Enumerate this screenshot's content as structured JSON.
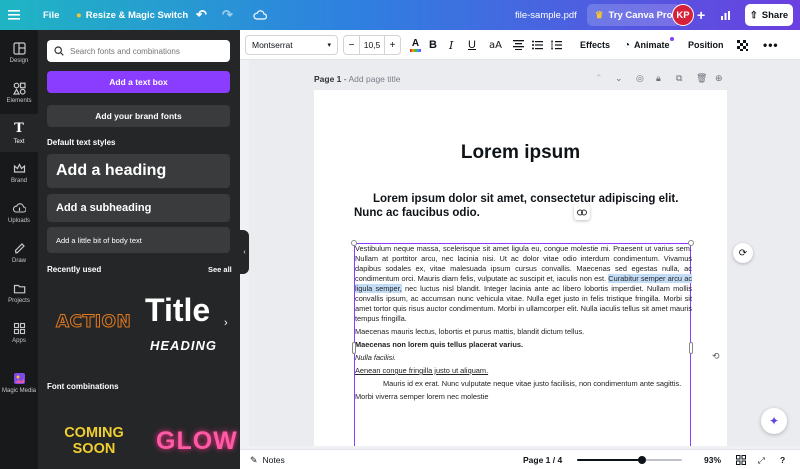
{
  "topbar": {
    "file": "File",
    "resize": "Resize & Magic Switch",
    "filename": "file-sample.pdf",
    "try_pro": "Try Canva Pro",
    "avatar_initials": "KP",
    "share": "Share",
    "gradient_colors": [
      "#1fb5c4",
      "#2f7fe0",
      "#6b3fe0"
    ]
  },
  "rail": {
    "items": [
      {
        "label": "Design",
        "icon": "layout-icon"
      },
      {
        "label": "Elements",
        "icon": "shapes-icon"
      },
      {
        "label": "Text",
        "icon": "text-icon"
      },
      {
        "label": "Brand",
        "icon": "crown-icon"
      },
      {
        "label": "Uploads",
        "icon": "upload-icon"
      },
      {
        "label": "Draw",
        "icon": "pen-icon"
      },
      {
        "label": "Projects",
        "icon": "folder-icon"
      },
      {
        "label": "Apps",
        "icon": "apps-icon"
      },
      {
        "label": "Magic Media",
        "icon": "magic-media-icon"
      }
    ],
    "active": "Text"
  },
  "panel": {
    "search_placeholder": "Search fonts and combinations",
    "add_text_box": "Add a text box",
    "add_brand_fonts": "Add your brand fonts",
    "default_styles_label": "Default text styles",
    "heading": "Add a heading",
    "subheading": "Add a subheading",
    "body": "Add a little bit of body text",
    "recently_used_label": "Recently used",
    "see_all": "See all",
    "recent": {
      "action": "ACTION",
      "title": "Title",
      "heading": "HEADING"
    },
    "font_combinations_label": "Font combinations",
    "combos": {
      "coming_soon_1": "COMING",
      "coming_soon_2": "SOON",
      "glow": "GLOW"
    }
  },
  "toolbar": {
    "font": "Montserrat",
    "size": "10,5",
    "effects": "Effects",
    "animate": "Animate",
    "position": "Position"
  },
  "canvas": {
    "page_label": "Page 1",
    "page_title_placeholder": "Add page title",
    "title": "Lorem ipsum",
    "subtitle": "Lorem ipsum dolor sit amet, consectetur adipiscing elit. Nunc ac faucibus odio.",
    "paragraph_1a": "Vestibulum neque massa, scelerisque sit amet ligula eu, congue molestie mi. Praesent ut varius sem. Nullam at porttitor arcu, nec lacinia nisi. Ut ac dolor vitae odio interdum condimentum. Vivamus dapibus sodales ex, vitae malesuada ipsum cursus convallis. Maecenas sed egestas nulla, ac condimentum orci. Mauris diam felis, vulputate ac suscipit et, iaculis non est.",
    "paragraph_1_highlight": "Curabitur semper arcu ac ligula semper,",
    "paragraph_1b": "nec luctus nisl blandit. Integer lacinia ante ac libero lobortis imperdiet. Nullam mollis convallis ipsum, ac accumsan nunc vehicula vitae. Nulla eget justo in felis tristique fringilla. Morbi sit amet tortor quis risus auctor condimentum. Morbi in ullamcorper elit. Nulla iaculis tellus sit amet mauris tempus fringilla.",
    "paragraph_2": "Maecenas mauris lectus, lobortis et purus mattis, blandit dictum tellus.",
    "item_bold": "Maecenas non lorem quis tellus placerat varius.",
    "item_italic": "Nulla facilisi.",
    "item_underline": "Aenean congue fringilla justo ut aliquam.",
    "item_indented": "Mauris id ex erat. Nunc vulputate neque vitae justo facilisis, non condimentum ante sagittis.",
    "item_last": "Morbi viverra semper lorem nec molestie"
  },
  "bottombar": {
    "notes": "Notes",
    "page_indicator": "Page 1 / 4",
    "zoom": "93%",
    "zoom_fraction": 0.62
  },
  "colors": {
    "accent": "#8b3dff",
    "panel_bg": "#252627",
    "rail_bg": "#18191b",
    "highlight": "#c4ddf7"
  }
}
